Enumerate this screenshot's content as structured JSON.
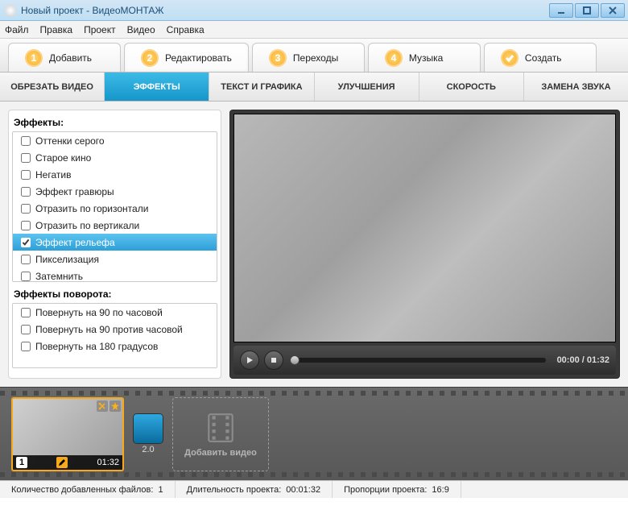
{
  "window": {
    "title": "Новый проект - ВидеоМОНТАЖ"
  },
  "menu": {
    "file": "Файл",
    "edit": "Правка",
    "project": "Проект",
    "video": "Видео",
    "help": "Справка"
  },
  "steps": {
    "add": {
      "num": "1",
      "label": "Добавить"
    },
    "edit": {
      "num": "2",
      "label": "Редактировать"
    },
    "trans": {
      "num": "3",
      "label": "Переходы"
    },
    "music": {
      "num": "4",
      "label": "Музыка"
    },
    "create": {
      "label": "Создать"
    }
  },
  "subtabs": {
    "crop": "ОБРЕЗАТЬ ВИДЕО",
    "effects": "ЭФФЕКТЫ",
    "text": "ТЕКСТ И ГРАФИКА",
    "improve": "УЛУЧШЕНИЯ",
    "speed": "СКОРОСТЬ",
    "audio": "ЗАМЕНА ЗВУКА"
  },
  "effects": {
    "header1": "Эффекты:",
    "items": [
      "Оттенки серого",
      "Старое кино",
      "Негатив",
      "Эффект гравюры",
      "Отразить по горизонтали",
      "Отразить по вертикали",
      "Эффект рельефа",
      "Пикселизация",
      "Затемнить"
    ],
    "selected_index": 6,
    "header2": "Эффекты поворота:",
    "rotate_items": [
      "Повернуть на 90 по часовой",
      "Повернуть на 90 против часовой",
      "Повернуть на 180 градусов"
    ]
  },
  "player": {
    "timecode": "00:00 / 01:32"
  },
  "timeline": {
    "clip": {
      "index": "1",
      "duration": "01:32"
    },
    "transition": {
      "duration": "2.0"
    },
    "add_label": "Добавить видео"
  },
  "status": {
    "files_label": "Количество добавленных файлов:",
    "files_value": "1",
    "duration_label": "Длительность проекта:",
    "duration_value": "00:01:32",
    "aspect_label": "Пропорции проекта:",
    "aspect_value": "16:9"
  }
}
